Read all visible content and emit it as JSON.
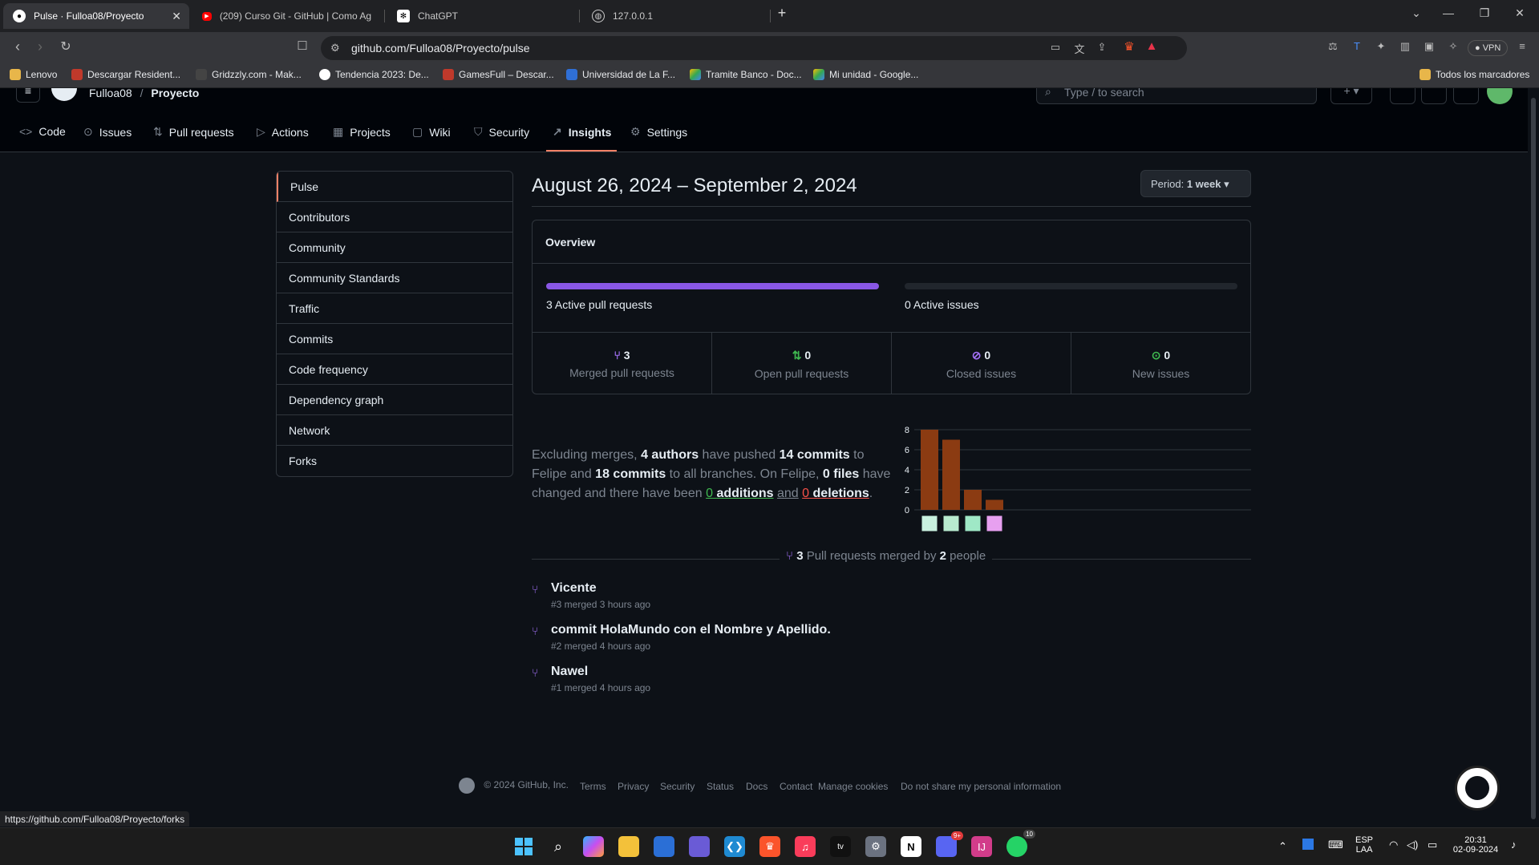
{
  "browser": {
    "tabs": [
      {
        "title": "Pulse · Fulloa08/Proyecto",
        "active": true
      },
      {
        "title": "(209) Curso Git - GitHub | Como Ag"
      },
      {
        "title": "ChatGPT"
      },
      {
        "title": "127.0.0.1"
      }
    ],
    "new_tab": "+",
    "url": "github.com/Fulloa08/Proyecto/pulse",
    "vpn": "VPN",
    "bookmarks": [
      "Lenovo",
      "Descargar Resident...",
      "Gridzzly.com - Mak...",
      "Tendencia 2023: De...",
      "GamesFull – Descar...",
      "Universidad de La F...",
      "Tramite Banco - Doc...",
      "Mi unidad - Google..."
    ],
    "all_bookmarks": "Todos los marcadores",
    "status_url": "https://github.com/Fulloa08/Proyecto/forks"
  },
  "github": {
    "owner": "Fulloa08",
    "separator": "/",
    "repo": "Proyecto",
    "search_placeholder": "Type / to search",
    "nav": [
      "Code",
      "Issues",
      "Pull requests",
      "Actions",
      "Projects",
      "Wiki",
      "Security",
      "Insights",
      "Settings"
    ]
  },
  "sidebar": {
    "items": [
      "Pulse",
      "Contributors",
      "Community",
      "Community Standards",
      "Traffic",
      "Commits",
      "Code frequency",
      "Dependency graph",
      "Network",
      "Forks"
    ]
  },
  "pulse": {
    "period_title": "August 26, 2024 – September 2, 2024",
    "period_prefix": "Period:",
    "period_value": "1 week",
    "overview": {
      "heading": "Overview",
      "active_prs_label": "3 Active pull requests",
      "active_prs_fraction": 1.0,
      "active_issues_label": "0 Active issues",
      "active_issues_fraction": 0.0,
      "stats": [
        {
          "value": "3",
          "label": "Merged pull requests",
          "icon": "git-merge-icon",
          "color": "#a371f7"
        },
        {
          "value": "0",
          "label": "Open pull requests",
          "icon": "git-pull-request-icon",
          "color": "#3fb950"
        },
        {
          "value": "0",
          "label": "Closed issues",
          "icon": "issue-closed-icon",
          "color": "#a371f7"
        },
        {
          "value": "0",
          "label": "New issues",
          "icon": "issue-opened-icon",
          "color": "#3fb950"
        }
      ]
    },
    "summary": {
      "p1": "Excluding merges,",
      "authors": "4 authors",
      "p2": "have pushed",
      "commits": "14 commits",
      "p3": "to Felipe and",
      "all_commits": "18 commits",
      "p4": "to all branches. On Felipe,",
      "files": "0 files",
      "p5": "have changed and there have been",
      "additions_num": "0",
      "additions": "additions",
      "and": "and",
      "deletions_num": "0",
      "deletions": "deletions",
      "end": "."
    },
    "merged": {
      "count": "3",
      "text1": "Pull requests merged by",
      "people_count": "2",
      "text2": "people",
      "items": [
        {
          "title": "Vicente",
          "meta": "#3 merged 3 hours ago"
        },
        {
          "title": "commit HolaMundo con el Nombre y Apellido.",
          "meta": "#2 merged 4 hours ago"
        },
        {
          "title": "Nawel",
          "meta": "#1 merged 4 hours ago"
        }
      ]
    }
  },
  "chart_data": {
    "type": "bar",
    "categories": [
      "author-1",
      "author-2",
      "author-3",
      "author-4"
    ],
    "values": [
      8,
      7,
      2,
      1
    ],
    "ylim": [
      0,
      8
    ],
    "yticks": [
      "8",
      "6",
      "4",
      "2",
      "0"
    ],
    "grid": true,
    "bar_color": "#8b3b12"
  },
  "footer": {
    "copyright": "© 2024 GitHub, Inc.",
    "links": [
      "Terms",
      "Privacy",
      "Security",
      "Status",
      "Docs",
      "Contact",
      "Manage cookies",
      "Do not share my personal information"
    ]
  },
  "taskbar": {
    "lang_top": "ESP",
    "lang_bottom": "LAA",
    "time": "20:31",
    "date": "02-09-2024",
    "discord_badge": "9+",
    "whatsapp_badge": "10"
  }
}
